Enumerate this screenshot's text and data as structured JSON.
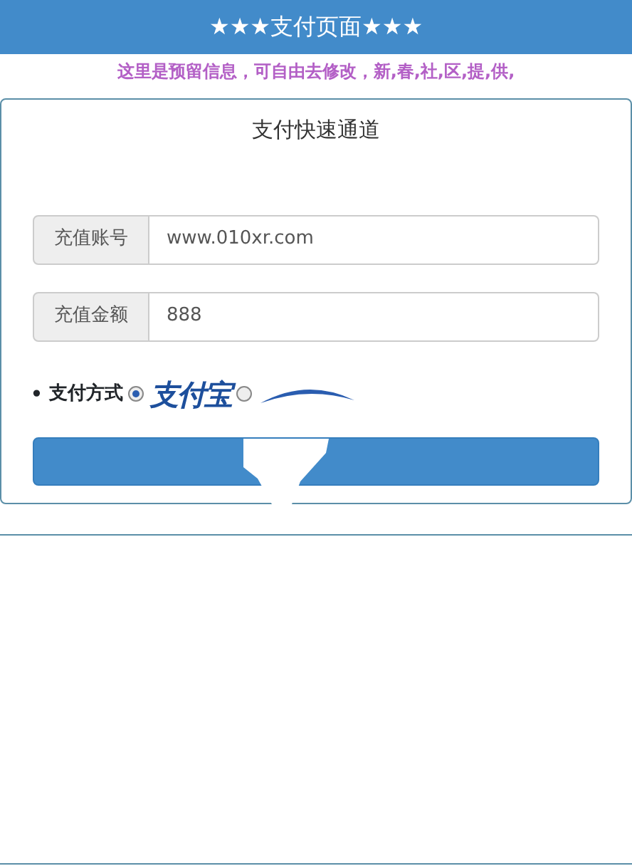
{
  "header": {
    "title": "★★★支付页面★★★"
  },
  "notice": "这里是预留信息，可自由去修改，新,春,社,区,提,供,",
  "form": {
    "title": "支付快速通道",
    "fields": [
      {
        "label": "充值账号",
        "value": "www.010xr.com"
      },
      {
        "label": "充值金额",
        "value": "888"
      }
    ],
    "payment": {
      "bullet": "•",
      "label": "支付方式",
      "options": [
        {
          "kind": "alipay",
          "logo_text": "支付宝",
          "selected": true
        },
        {
          "kind": "swoosh",
          "selected": false
        }
      ]
    }
  }
}
